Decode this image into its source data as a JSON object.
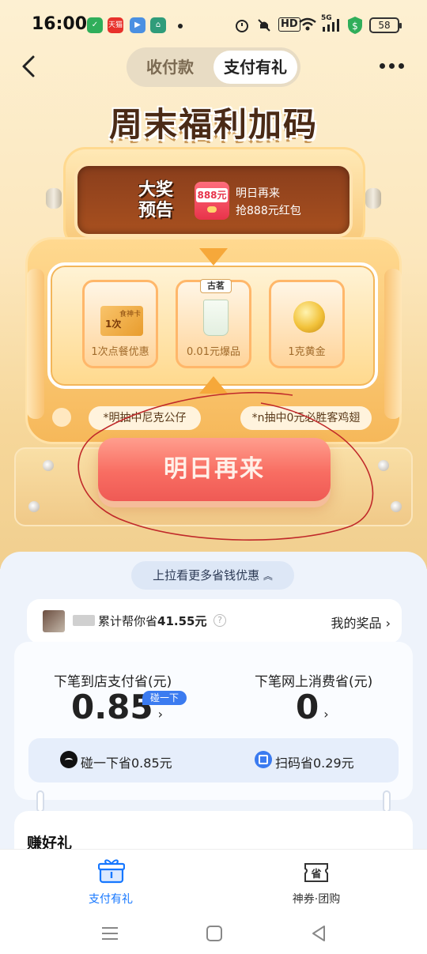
{
  "status_bar": {
    "time": "16:00",
    "battery": "58",
    "net": "5G",
    "hd": "HD",
    "apps": [
      {
        "name": "shield",
        "color": "#2fae5a",
        "text": ""
      },
      {
        "name": "tmall",
        "color": "#e8312b",
        "text": "天猫"
      },
      {
        "name": "video",
        "color": "#4a90e2",
        "text": ""
      },
      {
        "name": "anjuke",
        "color": "#2f9c7a",
        "text": ""
      }
    ]
  },
  "header": {
    "tabs": [
      {
        "label": "收付款",
        "active": false
      },
      {
        "label": "支付有礼",
        "active": true
      }
    ]
  },
  "banner": {
    "title": "周末福利加码",
    "preview_tag": "大奖预告",
    "preview_icon_amount": "888元",
    "preview_line1": "明日再来",
    "preview_line2": "抢888元红包"
  },
  "reels": [
    {
      "label": "1次点餐优惠",
      "card_text": "食神卡",
      "card_count": "1次"
    },
    {
      "label": "0.01元爆品",
      "tag": "古茗"
    },
    {
      "label": "1克黄金"
    }
  ],
  "tags": [
    "*明抽中尼克公仔",
    "*n抽中0元必胜客鸡翅"
  ],
  "main_button": "明日再来",
  "pull_hint": "上拉看更多省钱优惠",
  "savings": {
    "text_prefix": "累计帮你省",
    "amount": "41.55元",
    "my_prizes": "我的奖品"
  },
  "stats": {
    "left_label": "下笔到店支付省(元)",
    "left_value": "0.85",
    "badge": "碰一下",
    "right_label": "下笔网上消费省(元)",
    "right_value": "0",
    "bump_save": "碰一下省0.85元",
    "scan_save": "扫码省0.29元"
  },
  "gift_section": {
    "title": "赚好礼"
  },
  "bottom_nav": [
    {
      "label": "支付有礼",
      "active": true,
      "color": "#1677ff"
    },
    {
      "label": "神券·团购",
      "active": false,
      "color": "#333333"
    }
  ],
  "colors": {
    "accent": "#1677ff",
    "button_red": "#f86d62",
    "brown": "#8a3e1c"
  }
}
